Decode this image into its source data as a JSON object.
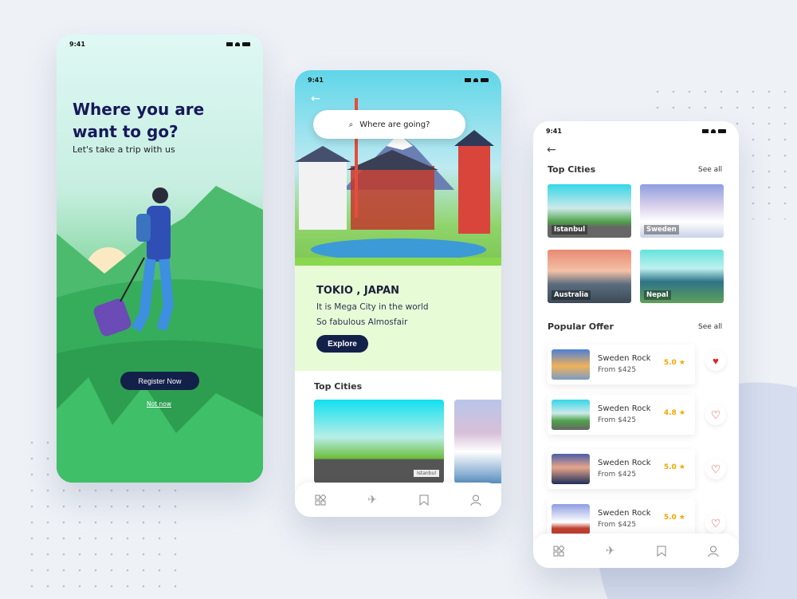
{
  "status_time": "9:41",
  "colors": {
    "accent": "#13214a",
    "rating": "#f5a700",
    "heart": "#e52020"
  },
  "onboarding": {
    "title": "Where you are want to go?",
    "subtitle": "Let's take a trip with us",
    "register_label": "Register Now",
    "skip_label": "Not now"
  },
  "home": {
    "search_placeholder": "Where are going?",
    "city": "TOKIO , JAPAN",
    "line1": "It is Mega City in the world",
    "line2": "So fabulous Almosfair",
    "explore_label": "Explore",
    "top_cities_title": "Top Cities",
    "card_label": "Istanbul"
  },
  "cities": {
    "top_cities_title": "Top Cities",
    "see_all": "See all",
    "tiles": [
      "Istanbul",
      "Sweden",
      "Australia",
      "Nepal"
    ],
    "popular_title": "Popular Offer",
    "offers": [
      {
        "title": "Sweden Rock",
        "price": "From $425",
        "rating": "5.0",
        "favorite": true
      },
      {
        "title": "Sweden Rock",
        "price": "From $425",
        "rating": "4.8",
        "favorite": false
      },
      {
        "title": "Sweden Rock",
        "price": "From $425",
        "rating": "5.0",
        "favorite": false
      },
      {
        "title": "Sweden Rock",
        "price": "From $425",
        "rating": "5.0",
        "favorite": false
      }
    ]
  },
  "nav_icons": [
    "grid-icon",
    "plane-icon",
    "bookmark-icon",
    "user-icon"
  ]
}
